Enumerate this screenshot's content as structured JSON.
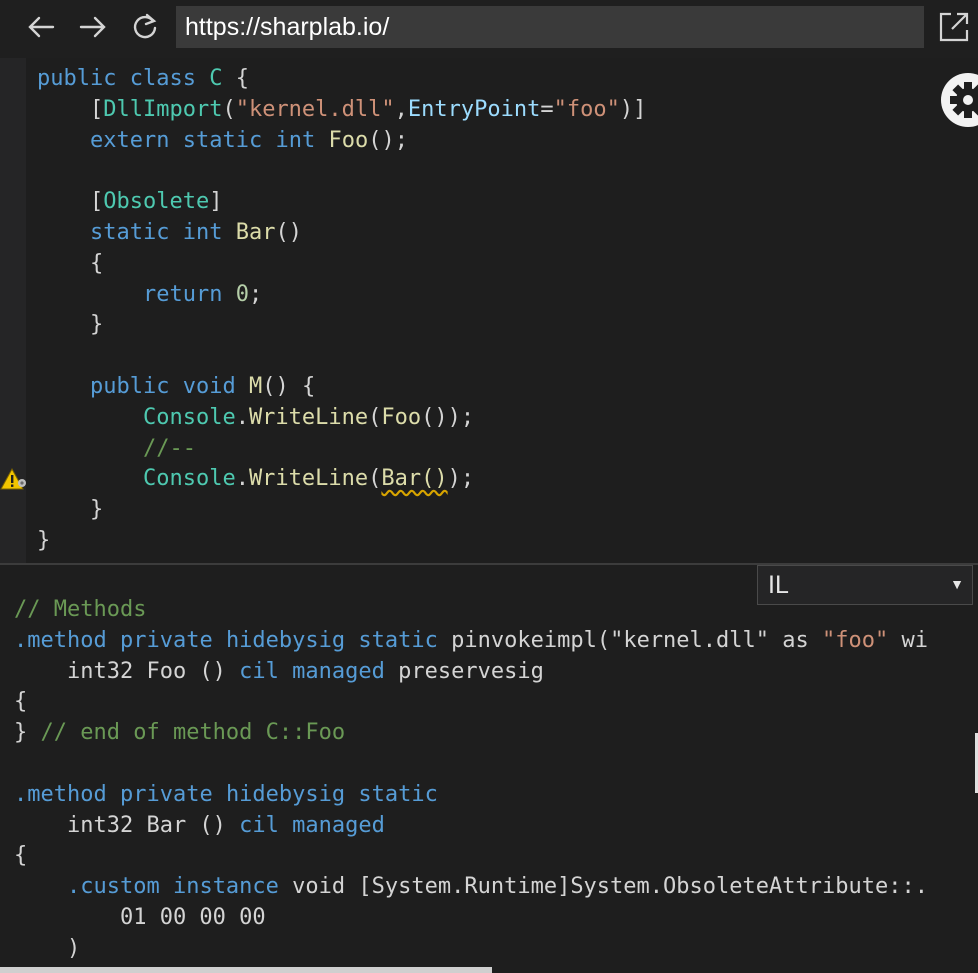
{
  "browser": {
    "url": "https://sharplab.io/",
    "back_label": "←",
    "forward_label": "→",
    "reload_label": "↻"
  },
  "editor": {
    "lines": [
      [
        [
          "kw",
          "public"
        ],
        [
          "pn",
          " "
        ],
        [
          "kw",
          "class"
        ],
        [
          "pn",
          " "
        ],
        [
          "ty",
          "C"
        ],
        [
          "pn",
          " {"
        ]
      ],
      [
        [
          "pn",
          "    ["
        ],
        [
          "ty",
          "DllImport"
        ],
        [
          "pn",
          "("
        ],
        [
          "st",
          "\"kernel.dll\""
        ],
        [
          "pn",
          ","
        ],
        [
          "id",
          "EntryPoint"
        ],
        [
          "pn",
          "="
        ],
        [
          "st",
          "\"foo\""
        ],
        [
          "pn",
          ")]"
        ]
      ],
      [
        [
          "pn",
          "    "
        ],
        [
          "kw",
          "extern"
        ],
        [
          "pn",
          " "
        ],
        [
          "kw",
          "static"
        ],
        [
          "pn",
          " "
        ],
        [
          "kw",
          "int"
        ],
        [
          "pn",
          " "
        ],
        [
          "fn",
          "Foo"
        ],
        [
          "pn",
          "();"
        ]
      ],
      [
        [
          "pn",
          ""
        ]
      ],
      [
        [
          "pn",
          "    ["
        ],
        [
          "ty",
          "Obsolete"
        ],
        [
          "pn",
          "]"
        ]
      ],
      [
        [
          "pn",
          "    "
        ],
        [
          "kw",
          "static"
        ],
        [
          "pn",
          " "
        ],
        [
          "kw",
          "int"
        ],
        [
          "pn",
          " "
        ],
        [
          "fn",
          "Bar"
        ],
        [
          "pn",
          "()"
        ]
      ],
      [
        [
          "pn",
          "    {"
        ]
      ],
      [
        [
          "pn",
          "        "
        ],
        [
          "kw",
          "return"
        ],
        [
          "pn",
          " "
        ],
        [
          "nm",
          "0"
        ],
        [
          "pn",
          ";"
        ]
      ],
      [
        [
          "pn",
          "    }"
        ]
      ],
      [
        [
          "pn",
          ""
        ]
      ],
      [
        [
          "pn",
          "    "
        ],
        [
          "kw",
          "public"
        ],
        [
          "pn",
          " "
        ],
        [
          "kw",
          "void"
        ],
        [
          "pn",
          " "
        ],
        [
          "fn",
          "M"
        ],
        [
          "pn",
          "() {"
        ]
      ],
      [
        [
          "pn",
          "        "
        ],
        [
          "ty",
          "Console"
        ],
        [
          "pn",
          "."
        ],
        [
          "fn",
          "WriteLine"
        ],
        [
          "pn",
          "("
        ],
        [
          "fn",
          "Foo"
        ],
        [
          "pn",
          "());"
        ]
      ],
      [
        [
          "pn",
          "        "
        ],
        [
          "cm",
          "//--"
        ]
      ],
      [
        [
          "pn",
          "        "
        ],
        [
          "ty",
          "Console"
        ],
        [
          "pn",
          "."
        ],
        [
          "fn",
          "WriteLine"
        ],
        [
          "pn",
          "("
        ],
        [
          "fn squig",
          "Bar()"
        ],
        [
          "pn",
          ");"
        ]
      ],
      [
        [
          "pn",
          "    }"
        ]
      ],
      [
        [
          "pn",
          "}"
        ]
      ]
    ],
    "warning_icon": "warning-icon",
    "settings_icon": "gear-icon"
  },
  "output": {
    "mode": "IL",
    "lines": [
      [
        [
          "cm",
          "// Methods"
        ]
      ],
      [
        [
          "kw",
          ".method"
        ],
        [
          "pn",
          " "
        ],
        [
          "kw",
          "private"
        ],
        [
          "pn",
          " "
        ],
        [
          "kw",
          "hidebysig"
        ],
        [
          "pn",
          " "
        ],
        [
          "kw",
          "static"
        ],
        [
          "pn",
          " pinvokeimpl(\"kernel.dll\" as "
        ],
        [
          "st",
          "\"foo\""
        ],
        [
          "pn",
          " wi"
        ]
      ],
      [
        [
          "pn",
          "    int32 Foo () "
        ],
        [
          "kw",
          "cil"
        ],
        [
          "pn",
          " "
        ],
        [
          "kw",
          "managed"
        ],
        [
          "pn",
          " preservesig"
        ]
      ],
      [
        [
          "pn",
          "{"
        ]
      ],
      [
        [
          "pn",
          "} "
        ],
        [
          "cm",
          "// end of method C::Foo"
        ]
      ],
      [
        [
          "pn",
          ""
        ]
      ],
      [
        [
          "kw",
          ".method"
        ],
        [
          "pn",
          " "
        ],
        [
          "kw",
          "private"
        ],
        [
          "pn",
          " "
        ],
        [
          "kw",
          "hidebysig"
        ],
        [
          "pn",
          " "
        ],
        [
          "kw",
          "static"
        ]
      ],
      [
        [
          "pn",
          "    int32 Bar () "
        ],
        [
          "kw",
          "cil"
        ],
        [
          "pn",
          " "
        ],
        [
          "kw",
          "managed"
        ]
      ],
      [
        [
          "pn",
          "{"
        ]
      ],
      [
        [
          "pn",
          "    "
        ],
        [
          "kw",
          ".custom"
        ],
        [
          "pn",
          " "
        ],
        [
          "kw",
          "instance"
        ],
        [
          "pn",
          " void [System.Runtime]System.ObsoleteAttribute::."
        ]
      ],
      [
        [
          "pn",
          "        01 00 00 00"
        ]
      ],
      [
        [
          "pn",
          "    )"
        ]
      ]
    ]
  }
}
